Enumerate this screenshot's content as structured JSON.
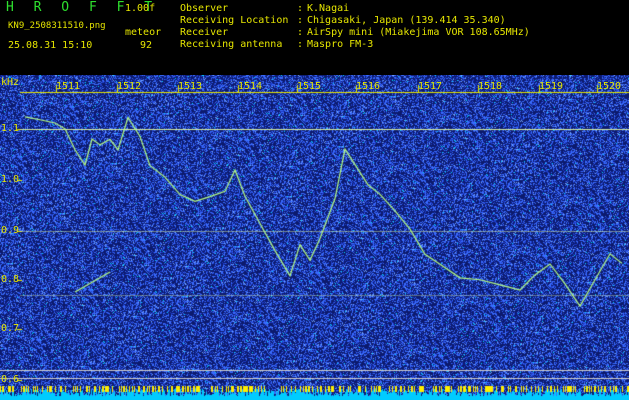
{
  "header": {
    "brand": "H R O F F T",
    "version": "1.00f",
    "filename": "KN9_2508311510.png",
    "meteor_label": "meteor",
    "timestamp": "25.08.31 15:10",
    "meteor_count": "92",
    "fields": [
      {
        "label": "Observer",
        "value": "K.Nagai"
      },
      {
        "label": "Receiving Location",
        "value": "Chigasaki, Japan (139.414 35.340)"
      },
      {
        "label": "Receiver",
        "value": "AirSpy mini (Miakejima VOR 108.65MHz)"
      },
      {
        "label": "Receiving antenna",
        "value": "Maspro FM-3"
      }
    ]
  },
  "spectrogram": {
    "y_unit": "kHz",
    "y_ticks": [
      "1.1",
      "1.0",
      "0.9",
      "0.8",
      "0.7",
      "0.6"
    ],
    "x_ticks": [
      "1511",
      "1512",
      "1513",
      "1514",
      "1515",
      "1516",
      "1517",
      "1518",
      "1519",
      "1520"
    ],
    "colors": {
      "background": "#0a1a6e",
      "noise": "#3a6cff",
      "signal": "#b8ff80",
      "line": "#d8f0a0",
      "text": "#e6e600",
      "bottom_bar": "#00ccff"
    }
  }
}
